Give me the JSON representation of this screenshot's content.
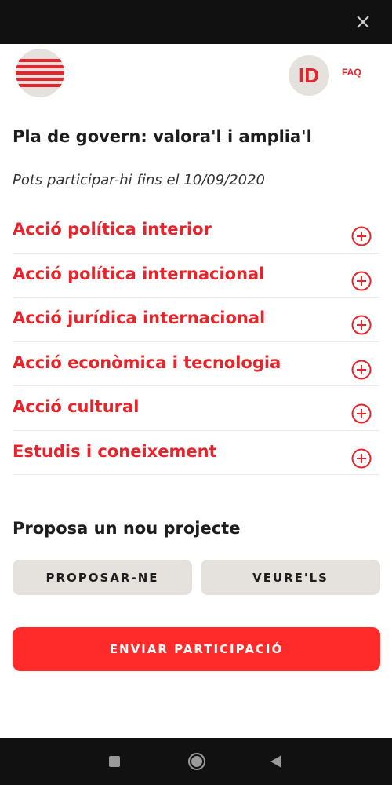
{
  "colors": {
    "accent": "#e8232b",
    "primary_button": "#ff2a2a",
    "secondary_button": "#e5e1dd",
    "text": "#1d1d1d",
    "system_bar": "#111111"
  },
  "header": {
    "logo_icon": "striped-flag-logo-icon",
    "id_label": "ID",
    "faq_label": "FAQ"
  },
  "main": {
    "title": "Pla de govern: valora'l i amplia'l",
    "subtitle": "Pots participar-hi fins el 10/09/2020",
    "sections": [
      {
        "label": "Acció política interior"
      },
      {
        "label": "Acció política internacional"
      },
      {
        "label": "Acció jurídica internacional"
      },
      {
        "label": "Acció econòmica i tecnologia"
      },
      {
        "label": "Acció cultural"
      },
      {
        "label": "Estudis i coneixement"
      }
    ],
    "proposa_title": "Proposa un nou projecte",
    "proposar_button": "PROPOSAR-NE",
    "veure_button": "VEURE'LS",
    "enviar_button": "ENVIAR PARTICIPACIÓ"
  }
}
